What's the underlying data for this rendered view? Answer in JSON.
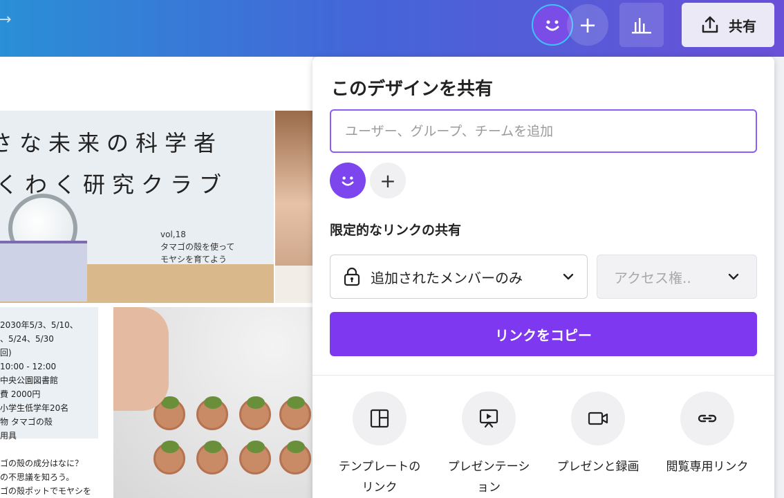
{
  "topbar": {
    "share_label": "共有"
  },
  "design": {
    "title_line1": "さな未来の科学者",
    "title_line2": "くわく研究クラブ",
    "vol_line1": "vol,18",
    "vol_line2": "タマゴの殻を使って",
    "vol_line3": "モヤシを育てよう",
    "info_lines": "2030年5/3、5/10、\n、5/24、5/30\n回)\n10:00 - 12:00\n中央公園図書館\n費 2000円\n小学生低学年20名\n物 タマゴの殻\n用具",
    "bottom_lines": "ゴの殻の成分はなに？\nの不思議を知ろう。\nゴの殻ポットでモヤシを"
  },
  "share_panel": {
    "title": "このデザインを共有",
    "input_placeholder": "ユーザー、グループ、チームを追加",
    "add_member": "+",
    "section_label": "限定的なリンクの共有",
    "members_select_value": "追加されたメンバーのみ",
    "access_select_value": "アクセス権..",
    "copy_link_label": "リンクをコピー",
    "options": [
      {
        "label_line1": "テンプレートの",
        "label_line2": "リンク",
        "icon": "template-icon"
      },
      {
        "label_line1": "プレゼンテーシ",
        "label_line2": "ョン",
        "icon": "presentation-icon"
      },
      {
        "label_line1": "プレゼンと録画",
        "label_line2": "",
        "icon": "video-camera-icon"
      },
      {
        "label_line1": "閲覧専用リンク",
        "label_line2": "",
        "icon": "link-icon"
      }
    ]
  },
  "colors": {
    "accent": "#7d38f0",
    "input_border": "#8d5cf6",
    "avatar": "#7d45ee"
  }
}
